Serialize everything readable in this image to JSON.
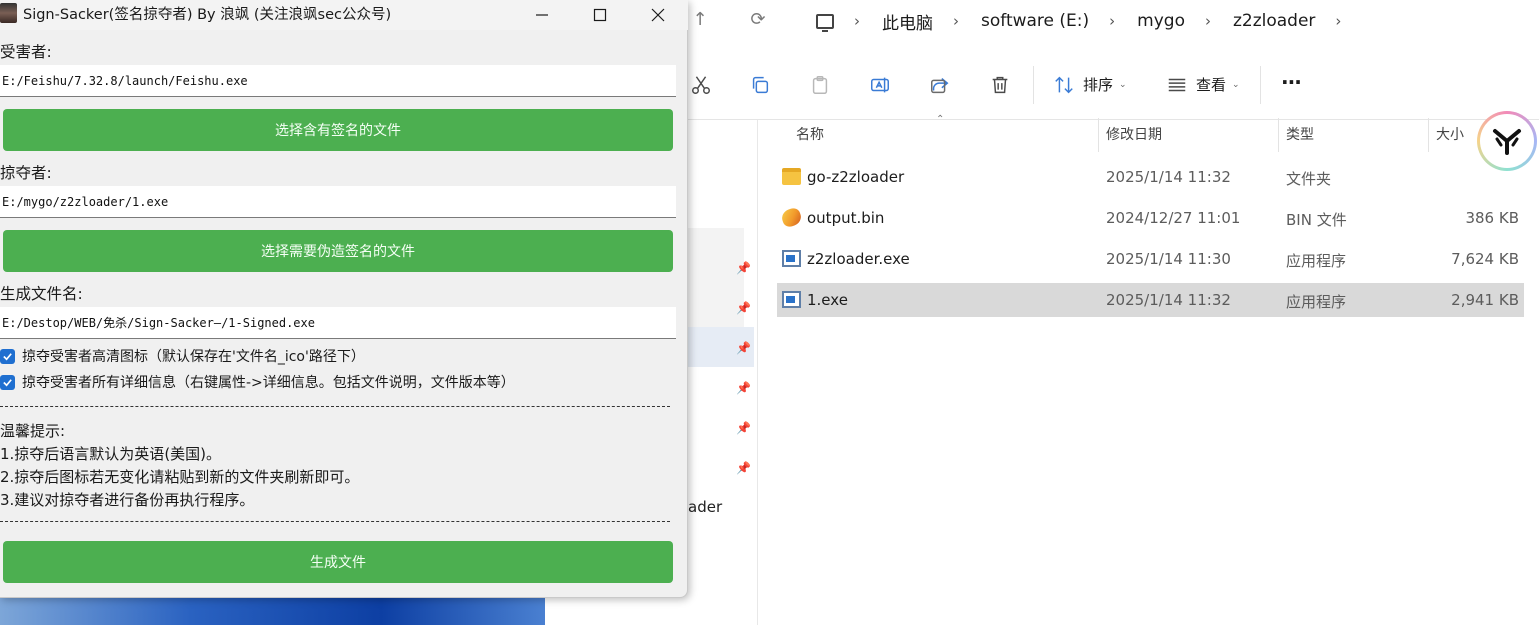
{
  "explorer": {
    "breadcrumb": [
      "此电脑",
      "software (E:)",
      "mygo",
      "z2zloader"
    ],
    "toolbar": {
      "sort_label": "排序",
      "view_label": "查看",
      "more_label": "···"
    },
    "columns": {
      "name": "名称",
      "modified": "修改日期",
      "type": "类型",
      "size": "大小"
    },
    "files": [
      {
        "name": "go-z2zloader",
        "modified": "2025/1/14 11:32",
        "type": "文件夹",
        "size": "",
        "icon": "folder-icon"
      },
      {
        "name": "output.bin",
        "modified": "2024/12/27 11:01",
        "type": "BIN 文件",
        "size": "386 KB",
        "icon": "bin-file-icon"
      },
      {
        "name": "z2zloader.exe",
        "modified": "2025/1/14 11:30",
        "type": "应用程序",
        "size": "7,624 KB",
        "icon": "exe-file-icon"
      },
      {
        "name": "1.exe",
        "modified": "2025/1/14 11:32",
        "type": "应用程序",
        "size": "2,941 KB",
        "icon": "exe-file-icon",
        "selected": true
      }
    ],
    "left_pane_partial_text": "ader"
  },
  "app": {
    "title": "Sign-Sacker(签名掠夺者) By 浪飒 (关注浪飒sec公众号)",
    "victim_label": "受害者:",
    "victim_path": "E:/Feishu/7.32.8/launch/Feishu.exe",
    "victim_button": "选择含有签名的文件",
    "plunderer_label": "掠夺者:",
    "plunderer_path": "E:/mygo/z2zloader/1.exe",
    "plunderer_button": "选择需要伪造签名的文件",
    "output_label": "生成文件名:",
    "output_path": "E:/Destop/WEB/免杀/Sign-Sacker—/1-Signed.exe",
    "option_icon": "掠夺受害者高清图标（默认保存在'文件名_ico'路径下）",
    "option_details": "掠夺受害者所有详细信息（右键属性->详细信息。包括文件说明，文件版本等）",
    "tips_title": "温馨提示:",
    "tips": [
      "1.掠夺后语言默认为英语(美国)。",
      "2.掠夺后图标若无变化请粘贴到新的文件夹刷新即可。",
      "3.建议对掠夺者进行备份再执行程序。"
    ],
    "generate_button": "生成文件",
    "accent_color": "#4caf50"
  }
}
